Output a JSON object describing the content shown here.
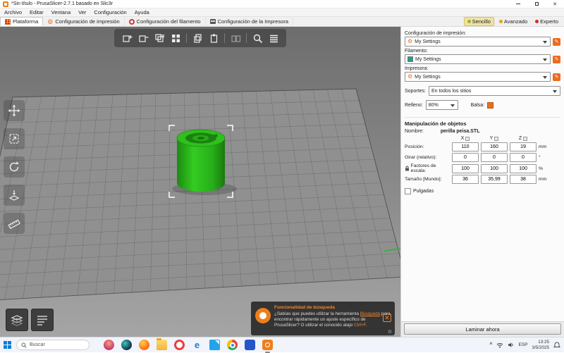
{
  "window": {
    "title": "*Sin título - PrusaSlicer-2.7.1 basado en Slic3r"
  },
  "menu": {
    "items": [
      "Archivo",
      "Editar",
      "Ventana",
      "Ver",
      "Configuración",
      "Ayuda"
    ]
  },
  "tabs": {
    "items": [
      {
        "label": "Plataforma"
      },
      {
        "label": "Configuración de impresión"
      },
      {
        "label": "Configuración del filamento"
      },
      {
        "label": "Configuración de la Impresora"
      }
    ],
    "modes": [
      {
        "label": "Sencillo",
        "color": "#9fb31c",
        "selected": true
      },
      {
        "label": "Avanzado",
        "color": "#e0a80f",
        "selected": false
      },
      {
        "label": "Experto",
        "color": "#d22f1e",
        "selected": false
      }
    ]
  },
  "sidebar": {
    "print_label": "Configuración de impresión:",
    "print_value": "My Settings",
    "filament_label": "Filamento:",
    "filament_value": "My Settings",
    "filament_swatch": "#1da189",
    "printer_label": "Impresora:",
    "printer_value": "My Settings",
    "supports_label": "Soportes:",
    "supports_value": "En todos los sitios",
    "infill_label": "Relleno:",
    "infill_value": "80%",
    "raft_label": "Balsa:",
    "manip_title": "Manipulación de objetos",
    "name_label": "Nombre:",
    "object_name": "perilla peisa.STL",
    "axis_headers": [
      "X",
      "Y",
      "Z"
    ],
    "rows": [
      {
        "label": "Posición:",
        "values": [
          "110",
          "160",
          "19"
        ],
        "unit": "mm"
      },
      {
        "label": "Girar (relativo):",
        "values": [
          "0",
          "0",
          "0"
        ],
        "unit": "°"
      },
      {
        "label": "Factores de escala:",
        "values": [
          "100",
          "100",
          "100"
        ],
        "unit": "%"
      },
      {
        "label": "Tamaño [Mundo]:",
        "values": [
          "36",
          "35,99",
          "38"
        ],
        "unit": "mm"
      }
    ],
    "inches_label": "Pulgadas",
    "slice_button_label": "Laminar ahora"
  },
  "toast": {
    "title": "Funcionalidad de búsqueda",
    "text_before": "¿Sabías que puedes utilizar la herramienta ",
    "link_text": "Búsqueda",
    "text_after": " para encontrar rápidamente un ajuste específico de PrusaSlicer? O utilizar el conocido atajo ",
    "shortcut": "Ctrl+F."
  },
  "taskbar": {
    "search_placeholder": "Buscar",
    "language": "ESP",
    "time": "13:25",
    "date": "3/5/2025"
  },
  "colors": {
    "accent": "#ED6B21",
    "object_green": "#2fc01d"
  },
  "icons": {
    "toolbar_top": [
      "add-object",
      "delete-object",
      "delete-all",
      "arrange",
      "copy",
      "paste",
      "split",
      "search",
      "layer-height"
    ],
    "toolbar_left": [
      "move",
      "scale",
      "rotate",
      "place-on-face",
      "measure"
    ]
  }
}
